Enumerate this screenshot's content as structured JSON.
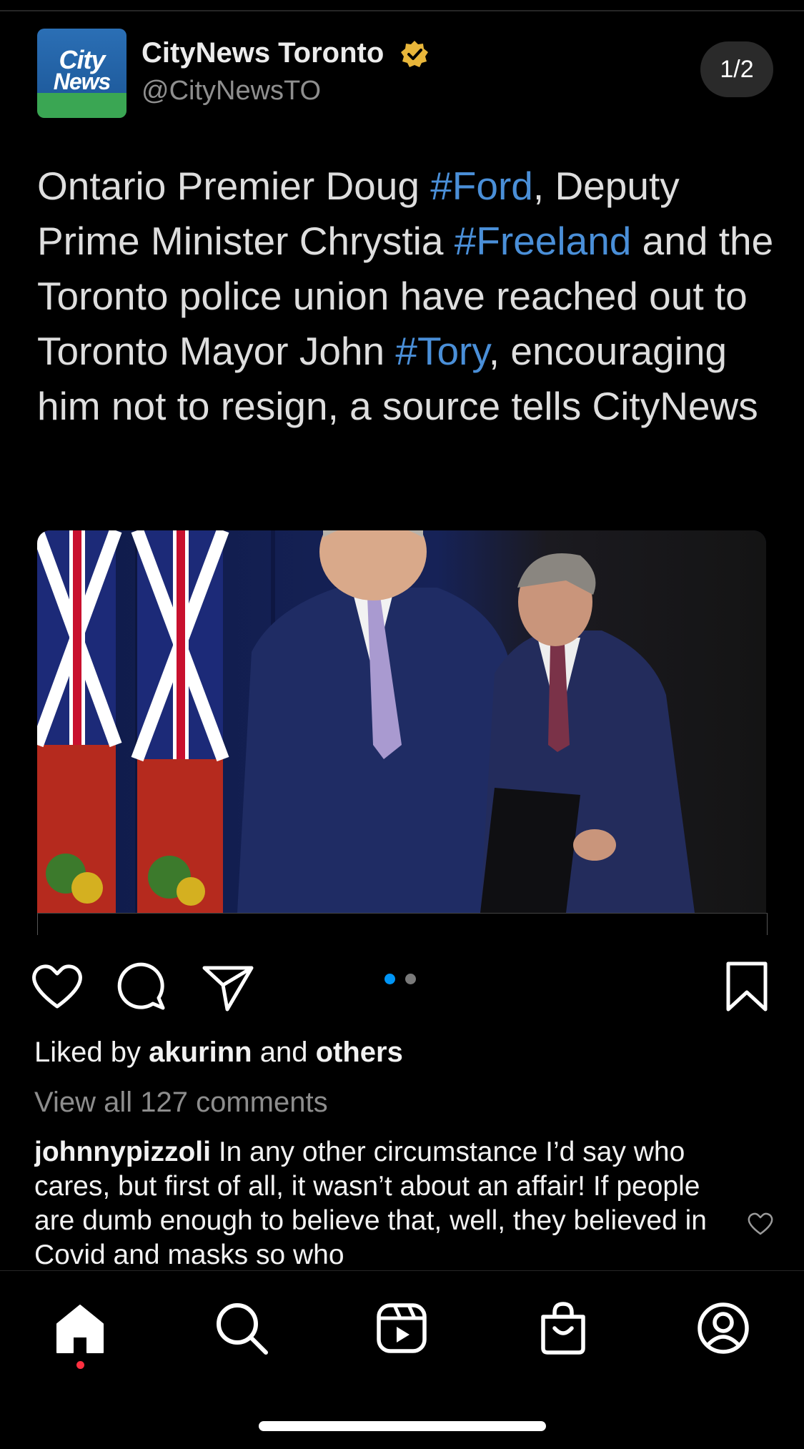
{
  "tweet": {
    "account_name": "CityNews Toronto",
    "handle": "@CityNewsTO",
    "logo_line1": "City",
    "logo_line2": "News",
    "page_indicator": "1/2",
    "text_parts": [
      {
        "text": "Ontario Premier Doug ",
        "tag": false
      },
      {
        "text": "#Ford",
        "tag": true
      },
      {
        "text": ", Deputy Prime Minister Chrystia ",
        "tag": false
      },
      {
        "text": "#Freeland",
        "tag": true
      },
      {
        "text": " and the Toronto police union have reached out to Toronto Mayor John ",
        "tag": false
      },
      {
        "text": "#Tory",
        "tag": true
      },
      {
        "text": ", encouraging him not to resign, a source tells CityNews",
        "tag": false
      }
    ]
  },
  "post": {
    "carousel_total": 2,
    "carousel_current": 1,
    "likes_prefix": "Liked by ",
    "liked_by_user": "akurinn",
    "likes_middle": " and ",
    "likes_others": "others",
    "view_comments": "View all 127 comments",
    "comment_user": "johnnypizzoli",
    "comment_text": "In any other circumstance I’d say who cares, but first of all, it wasn’t about an affair! If people are dumb enough to believe that, well, they believed in Covid and masks so who"
  },
  "icons": {
    "like": "heart-icon",
    "comment": "comment-bubble-icon",
    "share": "send-icon",
    "save": "bookmark-icon",
    "nav": [
      "home-icon",
      "search-icon",
      "reels-icon",
      "shop-icon",
      "profile-icon"
    ]
  },
  "colors": {
    "accent_blue": "#0095f6",
    "hashtag": "#4a8fd8",
    "notification": "#ff3040",
    "verified_badge": "#e8b63a"
  }
}
